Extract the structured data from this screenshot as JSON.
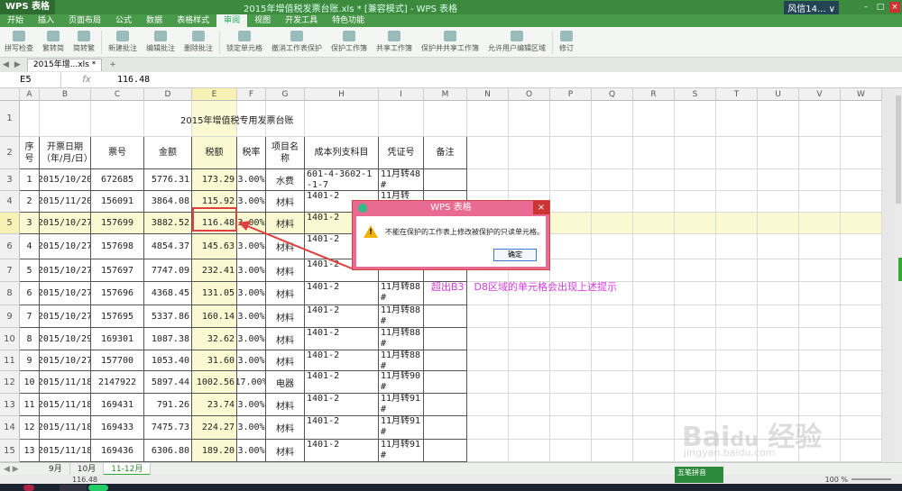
{
  "titlebar": {
    "app_label": "WPS 表格",
    "doc_title": "2015年增值税发票台账.xls * [兼容模式] - WPS 表格",
    "user_label": "风信14... ∨"
  },
  "menubar": {
    "items": [
      "开始",
      "插入",
      "页面布局",
      "公式",
      "数据",
      "表格样式",
      "审阅",
      "视图",
      "开发工具",
      "特色功能"
    ],
    "active": "审阅"
  },
  "ribbon": {
    "groups": [
      "拼写检查",
      "繁转简",
      "简转繁",
      "新建批注",
      "编辑批注",
      "删除批注",
      "锁定单元格",
      "撤消工作表保护",
      "保护工作簿",
      "共享工作簿",
      "保护并共享工作簿",
      "允许用户编辑区域",
      "修订"
    ]
  },
  "tabstrip": {
    "file_tab": "2015年增...xls *",
    "plus": "+"
  },
  "formula": {
    "namebox": "E5",
    "fx": "fx",
    "value": "116.48"
  },
  "columns": [
    "A",
    "B",
    "C",
    "D",
    "E",
    "F",
    "G",
    "H",
    "I",
    "M",
    "N",
    "O",
    "P",
    "Q",
    "R",
    "S",
    "T",
    "U",
    "V",
    "W"
  ],
  "title_text": "2015年增值税专用发票台账",
  "headers": {
    "seq": "序号",
    "date": "开票日期（年/月/日）",
    "ticket": "票号",
    "amount": "金额",
    "tax": "税额",
    "rate": "税率",
    "item": "项目名称",
    "account": "成本列支科目",
    "voucher": "凭证号",
    "note": "备注"
  },
  "rows": [
    {
      "r": "3",
      "seq": "1",
      "date": "2015/10/20",
      "ticket": "672685",
      "amount": "5776.31",
      "tax": "173.29",
      "rate": "3.00%",
      "item": "水费",
      "account": "601-4-3602-1-1-7",
      "voucher": "11月转48#"
    },
    {
      "r": "4",
      "seq": "2",
      "date": "2015/11/20",
      "ticket": "156091",
      "amount": "3864.08",
      "tax": "115.92",
      "rate": "3.00%",
      "item": "材料",
      "account": "1401-2",
      "voucher": "11月转"
    },
    {
      "r": "5",
      "seq": "3",
      "date": "2015/10/27",
      "ticket": "157699",
      "amount": "3882.52",
      "tax": "116.48",
      "rate": "3.00%",
      "item": "材料",
      "account": "1401-2",
      "voucher": ""
    },
    {
      "r": "6",
      "seq": "4",
      "date": "2015/10/27",
      "ticket": "157698",
      "amount": "4854.37",
      "tax": "145.63",
      "rate": "3.00%",
      "item": "材料",
      "account": "1401-2",
      "voucher": ""
    },
    {
      "r": "7",
      "seq": "5",
      "date": "2015/10/27",
      "ticket": "157697",
      "amount": "7747.09",
      "tax": "232.41",
      "rate": "3.00%",
      "item": "材料",
      "account": "1401-2",
      "voucher": "88#"
    },
    {
      "r": "8",
      "seq": "6",
      "date": "2015/10/27",
      "ticket": "157696",
      "amount": "4368.45",
      "tax": "131.05",
      "rate": "3.00%",
      "item": "材料",
      "account": "1401-2",
      "voucher": "11月转88#"
    },
    {
      "r": "9",
      "seq": "7",
      "date": "2015/10/27",
      "ticket": "157695",
      "amount": "5337.86",
      "tax": "160.14",
      "rate": "3.00%",
      "item": "材料",
      "account": "1401-2",
      "voucher": "11月转88#"
    },
    {
      "r": "10",
      "seq": "8",
      "date": "2015/10/29",
      "ticket": "169301",
      "amount": "1087.38",
      "tax": "32.62",
      "rate": "3.00%",
      "item": "材料",
      "account": "1401-2",
      "voucher": "11月转88#"
    },
    {
      "r": "11",
      "seq": "9",
      "date": "2015/10/27",
      "ticket": "157700",
      "amount": "1053.40",
      "tax": "31.60",
      "rate": "3.00%",
      "item": "材料",
      "account": "1401-2",
      "voucher": "11月转88#"
    },
    {
      "r": "12",
      "seq": "10",
      "date": "2015/11/18",
      "ticket": "2147922",
      "amount": "5897.44",
      "tax": "1002.56",
      "rate": "17.00%",
      "item": "电器",
      "account": "1401-2",
      "voucher": "11月转90#"
    },
    {
      "r": "13",
      "seq": "11",
      "date": "2015/11/18",
      "ticket": "169431",
      "amount": "791.26",
      "tax": "23.74",
      "rate": "3.00%",
      "item": "材料",
      "account": "1401-2",
      "voucher": "11月转91#"
    },
    {
      "r": "14",
      "seq": "12",
      "date": "2015/11/18",
      "ticket": "169433",
      "amount": "7475.73",
      "tax": "224.27",
      "rate": "3.00%",
      "item": "材料",
      "account": "1401-2",
      "voucher": "11月转91#"
    },
    {
      "r": "15",
      "seq": "13",
      "date": "2015/11/18",
      "ticket": "169436",
      "amount": "6306.80",
      "tax": "189.20",
      "rate": "3.00%",
      "item": "材料",
      "account": "1401-2",
      "voucher": "11月转91#"
    }
  ],
  "dialog": {
    "title": "WPS 表格",
    "message": "不能在保护的工作表上修改被保护的只读单元格。",
    "ok": "确定",
    "warn_glyph": "!"
  },
  "annotation": "超出B3：D8区域的单元格会出现上述提示",
  "sheets": [
    "9月",
    "10月",
    "11-12月"
  ],
  "active_sheet": "11-12月",
  "status": {
    "value": "116.48",
    "zoom": "100 %"
  },
  "ime": "五笔拼音",
  "watermark": "Bai du 经验",
  "watermark_url": "jingyan.baidu.com",
  "colors": {
    "title_green": "#3b8a3d",
    "highlight_yellow": "#fbf9d2",
    "dialog_pink": "#e96a92",
    "annotation_magenta": "#d53adf",
    "arrow_red": "#e04040"
  }
}
